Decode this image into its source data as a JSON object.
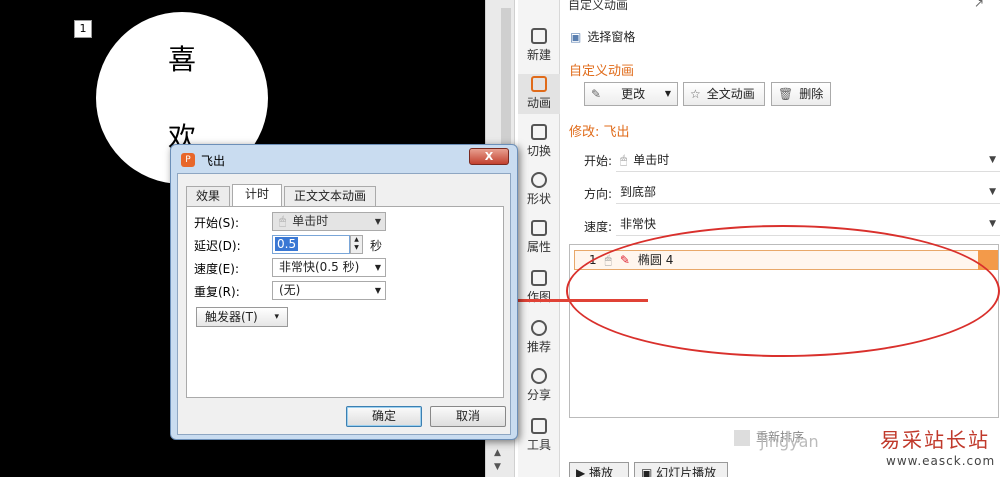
{
  "slide": {
    "number": "1",
    "text_line1": "喜",
    "text_line2": "欢"
  },
  "rail": [
    {
      "label": "新建",
      "icon": "new-doc-icon"
    },
    {
      "label": "动画",
      "icon": "animation-icon"
    },
    {
      "label": "切换",
      "icon": "transition-icon"
    },
    {
      "label": "形状",
      "icon": "shape-icon"
    },
    {
      "label": "属性",
      "icon": "properties-icon"
    },
    {
      "label": "作图",
      "icon": "image-icon"
    },
    {
      "label": "推荐",
      "icon": "recommend-icon"
    },
    {
      "label": "分享",
      "icon": "share-icon"
    },
    {
      "label": "工具",
      "icon": "tools-icon"
    }
  ],
  "pane": {
    "title": "自定义动画",
    "select_pane": "选择窗格",
    "section_title": "自定义动画",
    "change_btn": "更改",
    "full_text_btn": "全文动画",
    "delete_btn": "删除",
    "modify_title": "修改: 飞出",
    "start_label": "开始:",
    "start_value": "单击时",
    "direction_label": "方向:",
    "direction_value": "到底部",
    "speed_label": "速度:",
    "speed_value": "非常快",
    "item_index": "1",
    "item_name": "椭圆 4",
    "reorder": "重新排序",
    "play_btn": "播放",
    "slideshow_btn": "幻灯片播放"
  },
  "dialog": {
    "title": "飞出",
    "close": "X",
    "tabs": [
      "效果",
      "计时",
      "正文文本动画"
    ],
    "start_label": "开始(S):",
    "start_value": "单击时",
    "delay_label": "延迟(D):",
    "delay_value": "0.5",
    "delay_unit": "秒",
    "speed_label": "速度(E):",
    "speed_value": "非常快(0.5 秒)",
    "repeat_label": "重复(R):",
    "repeat_value": "(无)",
    "trigger_btn": "触发器(T)",
    "ok": "确定",
    "cancel": "取消"
  },
  "watermark": {
    "cn": "易采站长站",
    "url": "www.easck.com"
  },
  "colors": {
    "annotation": "#d9302c",
    "accent": "#e06b1a"
  }
}
